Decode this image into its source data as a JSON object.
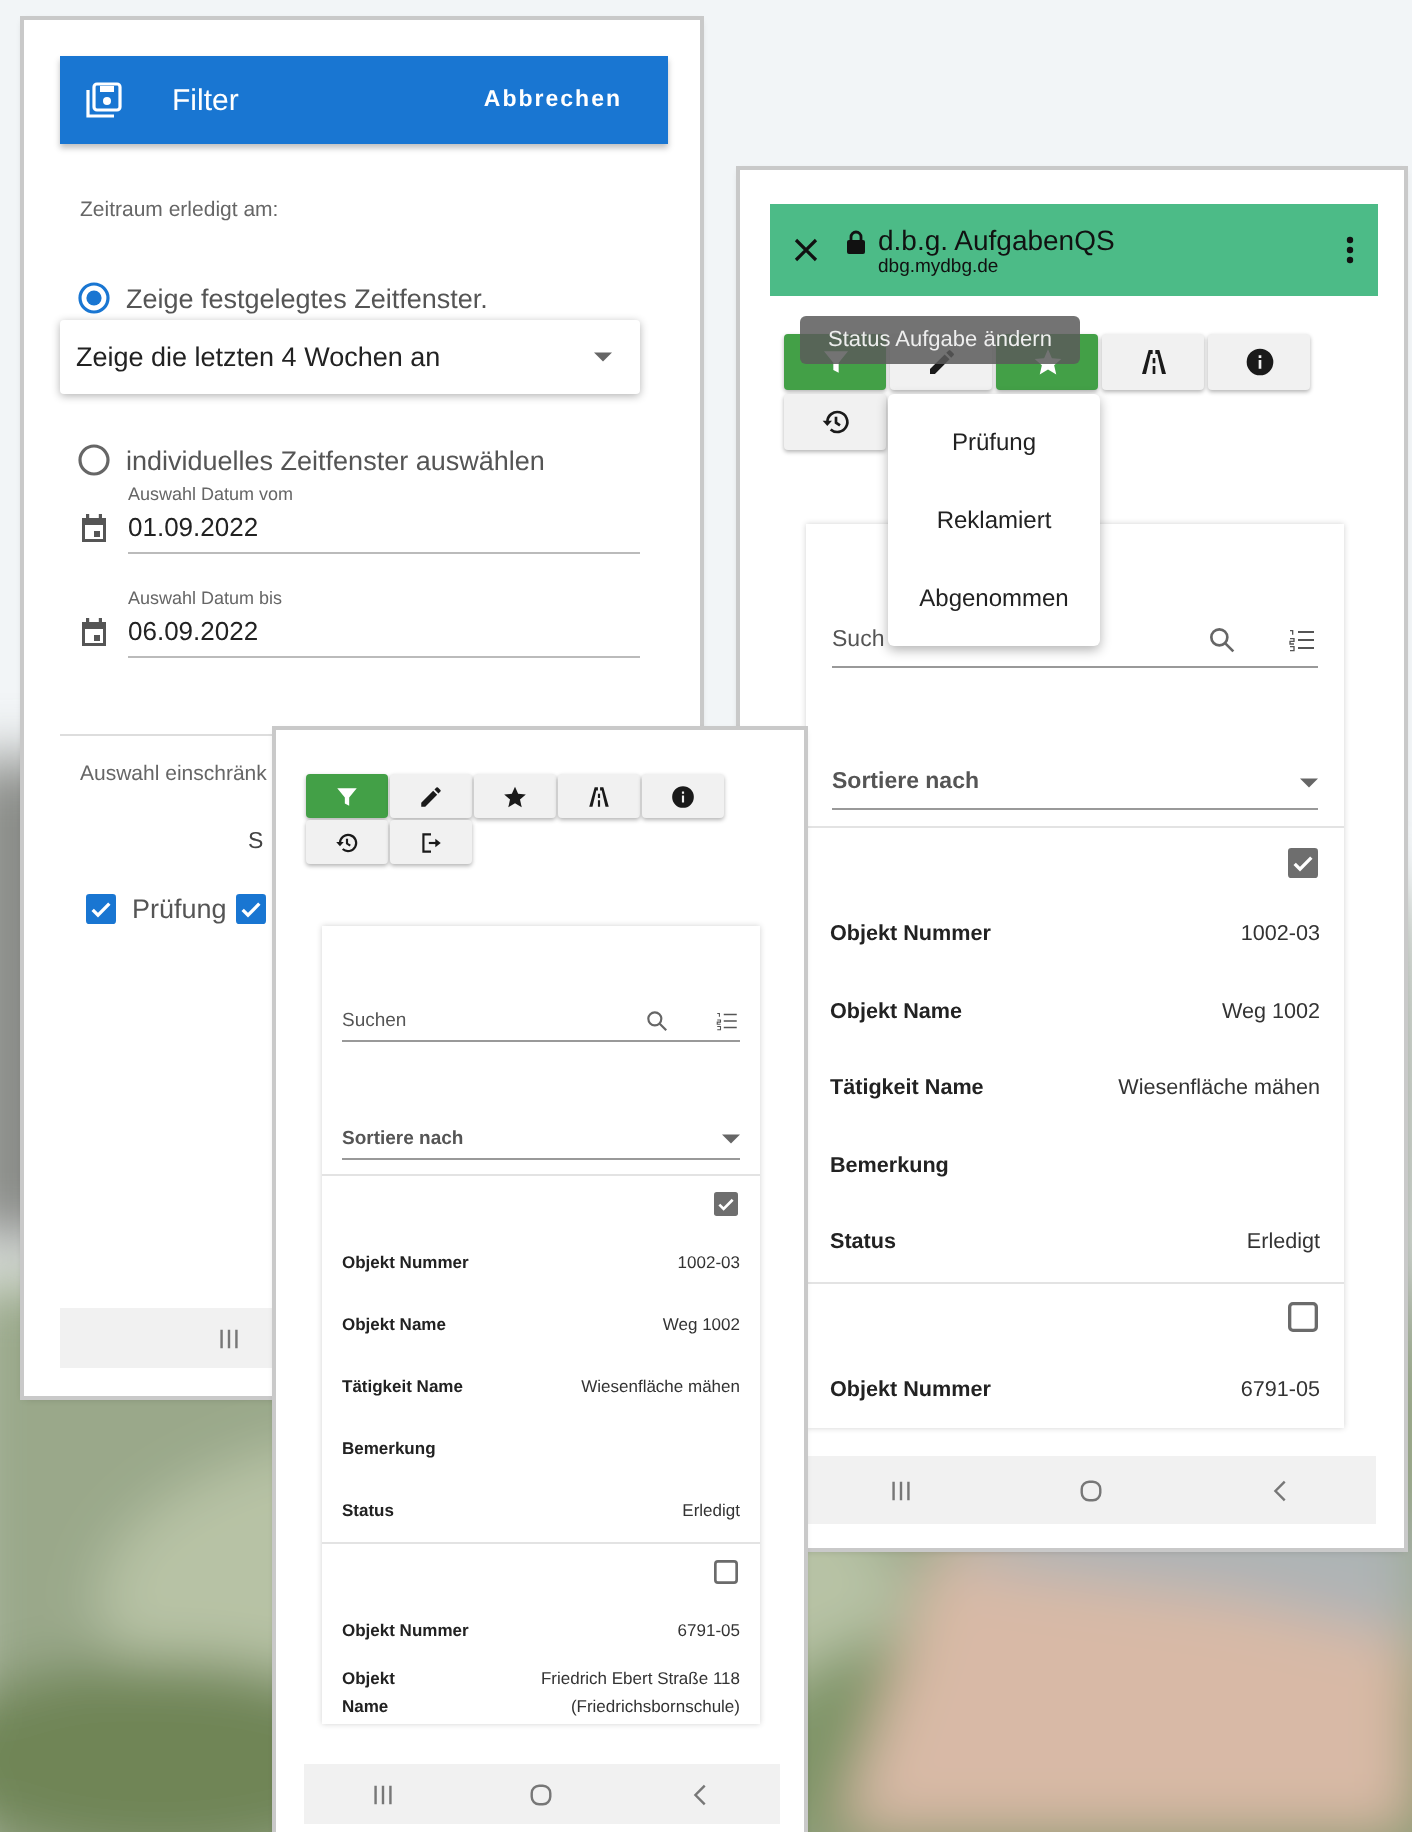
{
  "filter_screen": {
    "header": {
      "title": "Filter",
      "action": "Abbrechen"
    },
    "section_label": "Zeitraum erledigt am:",
    "options": [
      {
        "label": "Zeige festgelegtes Zeitfenster.",
        "selected": true
      },
      {
        "label": "individuelles Zeitfenster auswählen",
        "selected": false
      }
    ],
    "period_dropdown": {
      "value": "Zeige die letzten 4 Wochen an"
    },
    "date_fields": [
      {
        "label": "Auswahl Datum vom",
        "value": "01.09.2022"
      },
      {
        "label": "Auswahl Datum bis",
        "value": "06.09.2022"
      }
    ],
    "restrict_label": "Auswahl einschränk",
    "status_heading": "S",
    "status_checkboxes": [
      {
        "label": "Prüfung",
        "checked": true
      },
      {
        "checked": true
      }
    ]
  },
  "browser_task_screen": {
    "browser_bar": {
      "title": "d.b.g. AufgabenQS",
      "url": "dbg.mydbg.de"
    },
    "toolbar": [
      {
        "kind": "filter",
        "selected": true
      },
      {
        "kind": "edit",
        "selected": false
      },
      {
        "kind": "favorite",
        "selected": true
      },
      {
        "kind": "road",
        "selected": false
      },
      {
        "kind": "info",
        "selected": false
      },
      {
        "kind": "history",
        "selected": false
      }
    ],
    "tooltip": "Status Aufgabe ändern",
    "status_menu": [
      "Prüfung",
      "Reklamiert",
      "Abgenommen"
    ],
    "search": {
      "placeholder": "Such"
    },
    "sort": {
      "placeholder": "Sortiere nach"
    },
    "tasks": [
      {
        "checked": true,
        "fields": [
          {
            "label": "Objekt Nummer",
            "value": "1002-03"
          },
          {
            "label": "Objekt Name",
            "value": "Weg 1002"
          },
          {
            "label": "Tätigkeit Name",
            "value": "Wiesenfläche mähen"
          },
          {
            "label": "Bemerkung"
          },
          {
            "label": "Status",
            "value": "Erledigt"
          }
        ]
      },
      {
        "checked": false,
        "fields": [
          {
            "label": "Objekt Nummer",
            "value": "6791-05"
          }
        ]
      }
    ]
  },
  "task_screen": {
    "toolbar": [
      {
        "kind": "filter",
        "selected": true
      },
      {
        "kind": "edit",
        "selected": false
      },
      {
        "kind": "favorite",
        "selected": false
      },
      {
        "kind": "road",
        "selected": false
      },
      {
        "kind": "info",
        "selected": false
      },
      {
        "kind": "history",
        "selected": false
      },
      {
        "kind": "logout",
        "selected": false
      }
    ],
    "search": {
      "placeholder": "Suchen"
    },
    "sort": {
      "placeholder": "Sortiere nach"
    },
    "tasks": [
      {
        "checked": true,
        "fields": [
          {
            "label": "Objekt Nummer",
            "value": "1002-03"
          },
          {
            "label": "Objekt Name",
            "value": "Weg 1002"
          },
          {
            "label": "Tätigkeit Name",
            "value": "Wiesenfläche mähen"
          },
          {
            "label": "Bemerkung"
          },
          {
            "label": "Status",
            "value": "Erledigt"
          }
        ]
      },
      {
        "checked": false,
        "fields": [
          {
            "label": "Objekt Nummer",
            "value": "6791-05"
          },
          {
            "label": "Objekt Name",
            "value": "Friedrich Ebert Straße 118 (Friedrichsbornschule)"
          }
        ]
      }
    ]
  }
}
